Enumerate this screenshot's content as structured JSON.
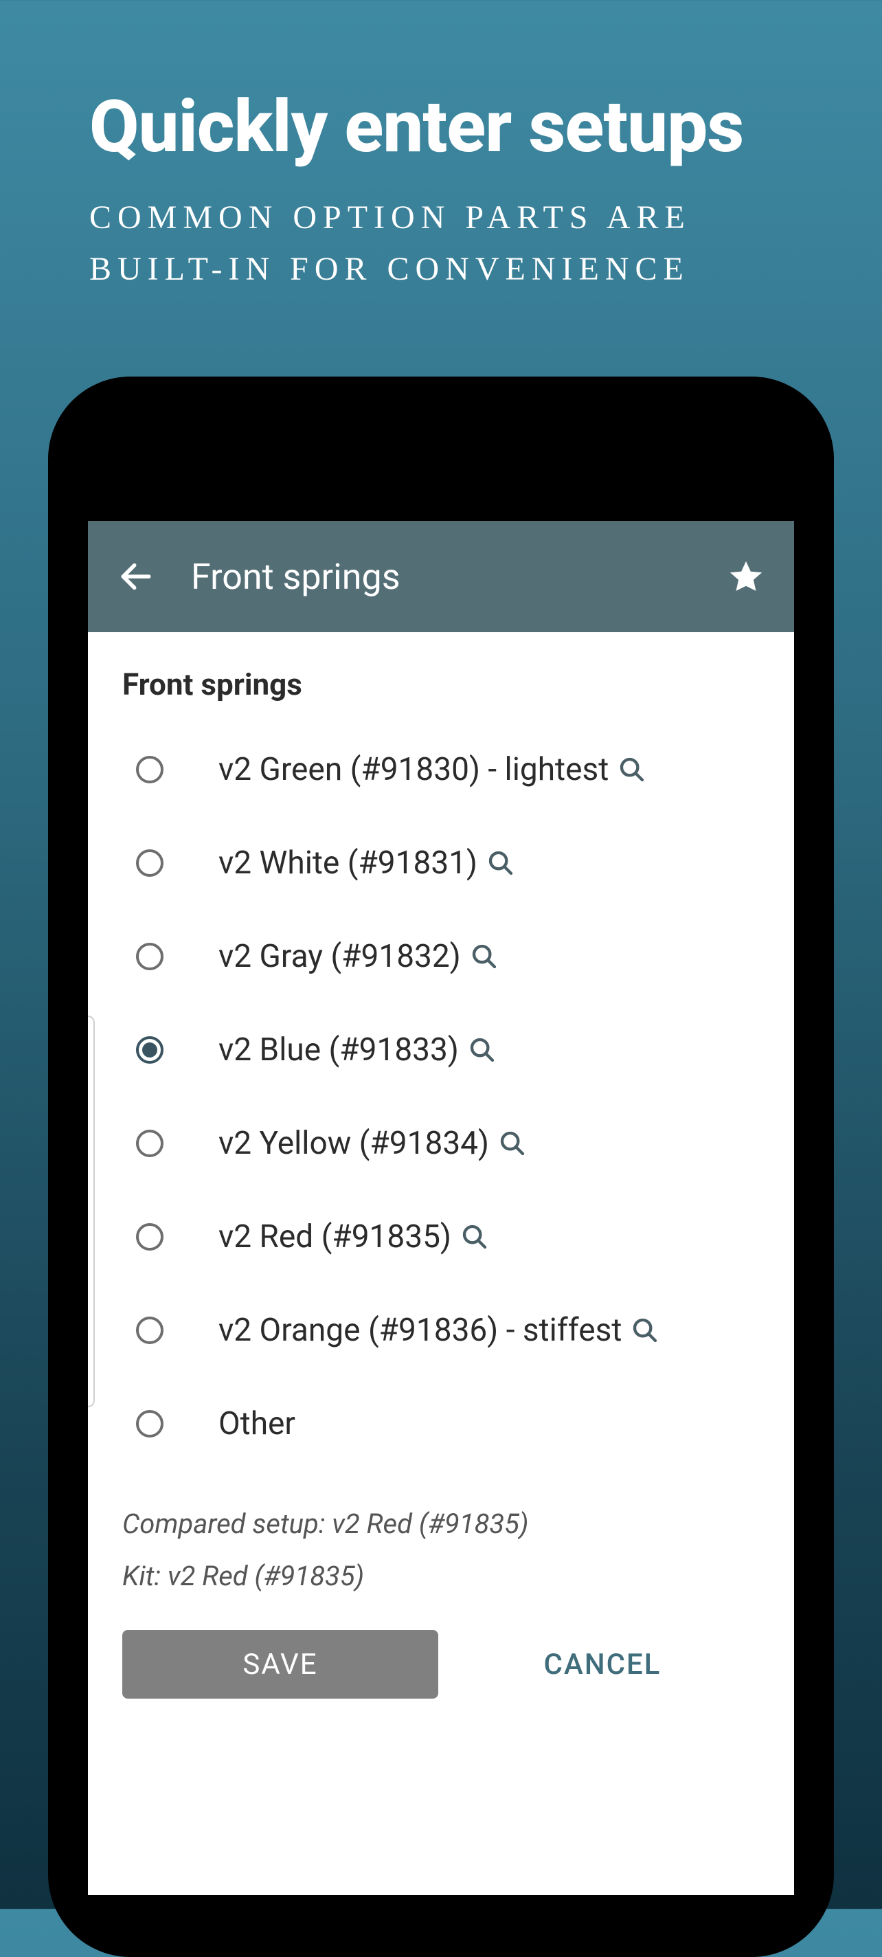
{
  "promo": {
    "title": "Quickly enter setups",
    "subtitle": "COMMON OPTION PARTS ARE BUILT-IN FOR CONVENIENCE"
  },
  "appbar": {
    "title": "Front springs"
  },
  "section_label": "Front springs",
  "options": [
    {
      "label": "v2 Green (#91830) - lightest",
      "selected": false,
      "has_search": true
    },
    {
      "label": "v2 White (#91831)",
      "selected": false,
      "has_search": true
    },
    {
      "label": "v2 Gray (#91832)",
      "selected": false,
      "has_search": true
    },
    {
      "label": "v2 Blue (#91833)",
      "selected": true,
      "has_search": true
    },
    {
      "label": "v2 Yellow (#91834)",
      "selected": false,
      "has_search": true
    },
    {
      "label": "v2 Red (#91835)",
      "selected": false,
      "has_search": true
    },
    {
      "label": "v2 Orange (#91836) - stiffest",
      "selected": false,
      "has_search": true
    },
    {
      "label": "Other",
      "selected": false,
      "has_search": false
    }
  ],
  "compared_line": "Compared setup: v2 Red (#91835)",
  "kit_line": "Kit: v2 Red (#91835)",
  "buttons": {
    "save": "SAVE",
    "cancel": "CANCEL"
  }
}
